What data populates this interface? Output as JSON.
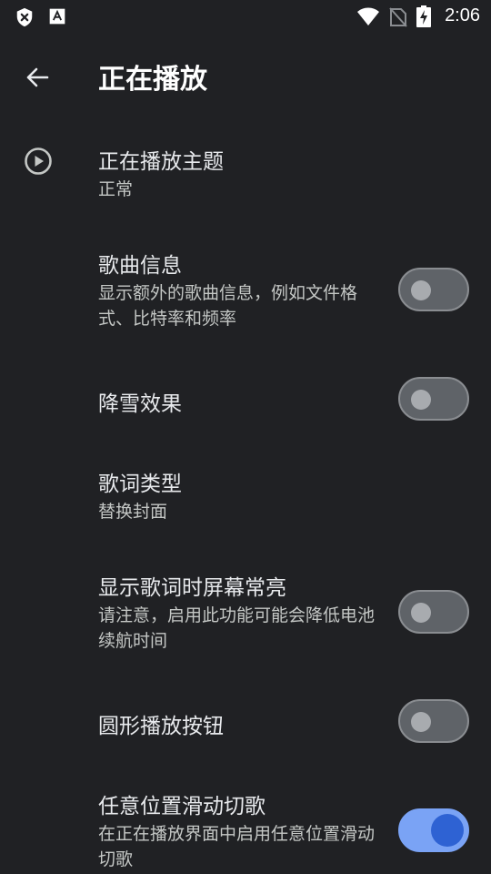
{
  "status_bar": {
    "time": "2:06"
  },
  "app_bar": {
    "title": "正在播放"
  },
  "preferences": [
    {
      "title": "正在播放主题",
      "summary": "正常"
    },
    {
      "title": "歌曲信息",
      "summary": "显示额外的歌曲信息，例如文件格式、比特率和频率",
      "checked": false
    },
    {
      "title": "降雪效果",
      "checked": false
    },
    {
      "title": "歌词类型",
      "summary": "替换封面"
    },
    {
      "title": "显示歌词时屏幕常亮",
      "summary": "请注意，启用此功能可能会降低电池续航时间",
      "checked": false
    },
    {
      "title": "圆形播放按钮",
      "checked": false
    },
    {
      "title": "任意位置滑动切歌",
      "summary": "在正在播放界面中启用任意位置滑动切歌",
      "checked": true
    }
  ],
  "colors": {
    "background": "#202124",
    "switch_on_track": "#7aa3f5",
    "switch_on_thumb": "#2e62d3",
    "switch_off_track": "#5f6368"
  }
}
